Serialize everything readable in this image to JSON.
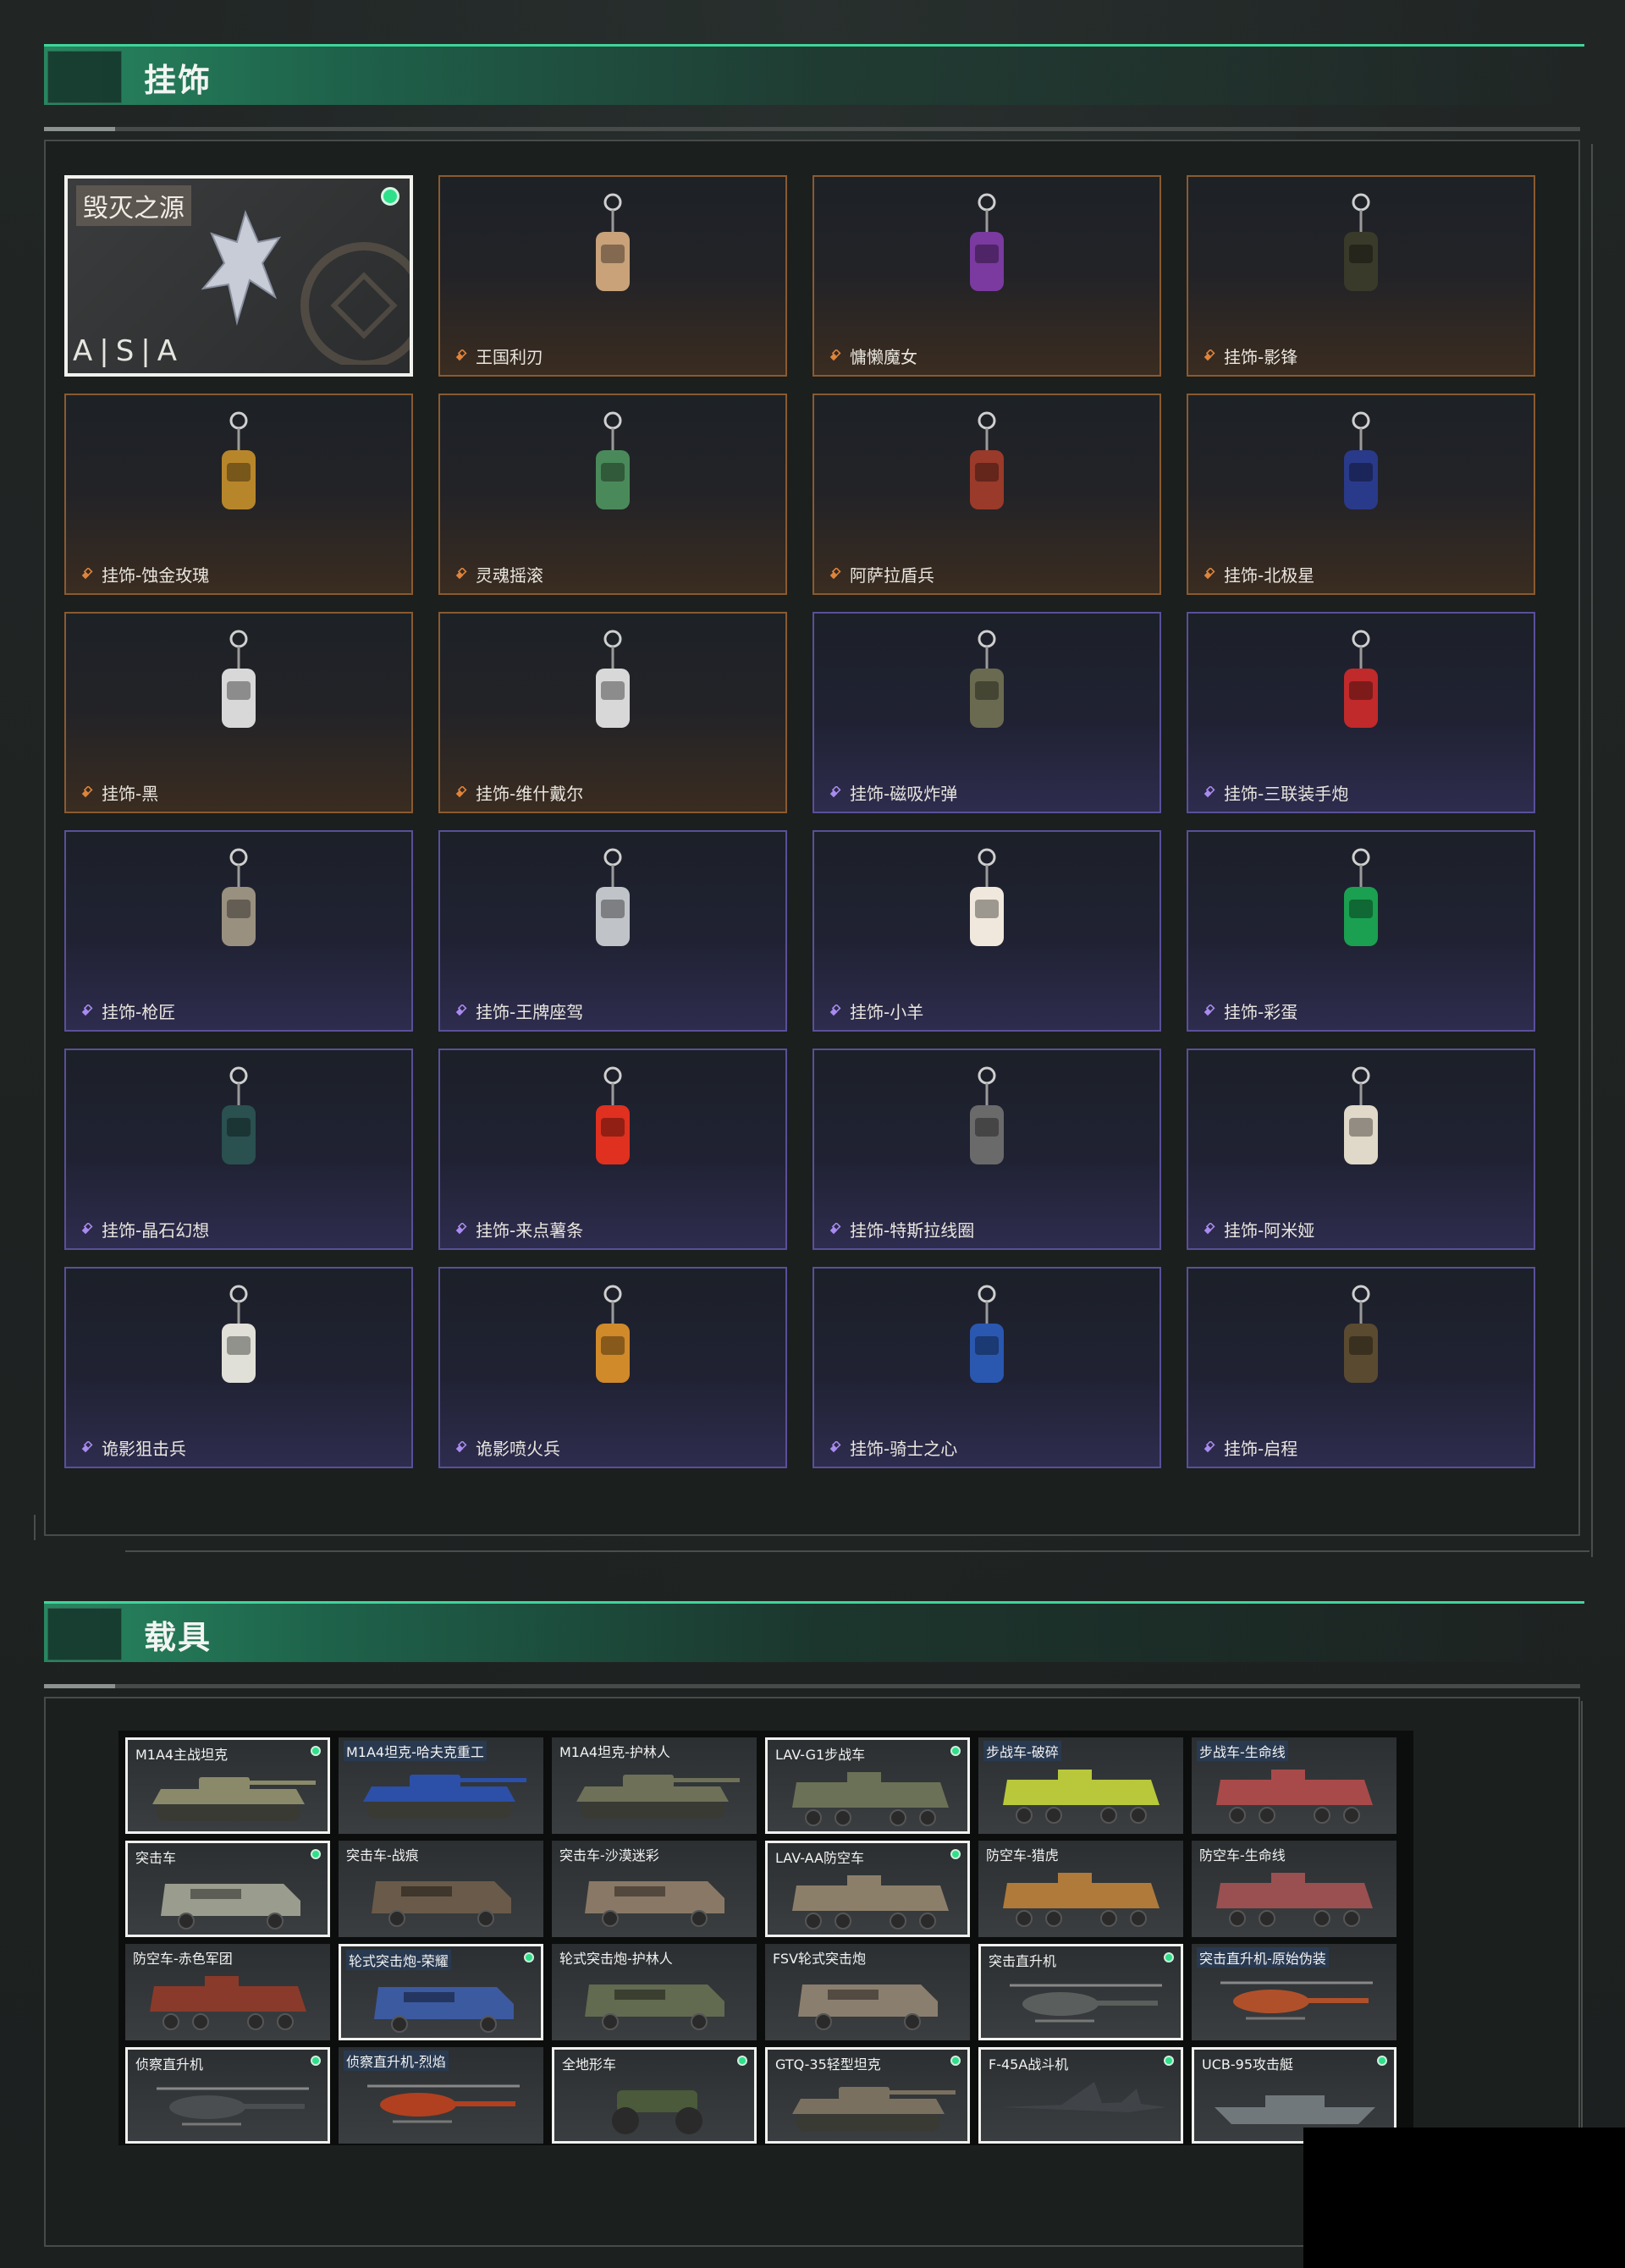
{
  "sections": {
    "charms": {
      "title": "挂饰"
    },
    "vehicles": {
      "title": "载具"
    }
  },
  "featured": {
    "title": "毁灭之源",
    "brand": "A|S|A"
  },
  "charms": [
    {
      "label": "王国利刃",
      "rarity": "orange"
    },
    {
      "label": "慵懒魔女",
      "rarity": "orange"
    },
    {
      "label": "挂饰-影锋",
      "rarity": "orange"
    },
    {
      "label": "挂饰-蚀金玫瑰",
      "rarity": "orange"
    },
    {
      "label": "灵魂摇滚",
      "rarity": "orange"
    },
    {
      "label": "阿萨拉盾兵",
      "rarity": "orange"
    },
    {
      "label": "挂饰-北极星",
      "rarity": "orange"
    },
    {
      "label": "挂饰-黑",
      "rarity": "orange"
    },
    {
      "label": "挂饰-维什戴尔",
      "rarity": "orange"
    },
    {
      "label": "挂饰-磁吸炸弹",
      "rarity": "purple"
    },
    {
      "label": "挂饰-三联装手炮",
      "rarity": "purple"
    },
    {
      "label": "挂饰-枪匠",
      "rarity": "purple"
    },
    {
      "label": "挂饰-王牌座驾",
      "rarity": "purple"
    },
    {
      "label": "挂饰-小羊",
      "rarity": "purple"
    },
    {
      "label": "挂饰-彩蛋",
      "rarity": "purple"
    },
    {
      "label": "挂饰-晶石幻想",
      "rarity": "purple"
    },
    {
      "label": "挂饰-来点薯条",
      "rarity": "purple"
    },
    {
      "label": "挂饰-特斯拉线圈",
      "rarity": "purple"
    },
    {
      "label": "挂饰-阿米娅",
      "rarity": "purple"
    },
    {
      "label": "诡影狙击兵",
      "rarity": "purple"
    },
    {
      "label": "诡影喷火兵",
      "rarity": "purple"
    },
    {
      "label": "挂饰-骑士之心",
      "rarity": "purple"
    },
    {
      "label": "挂饰-启程",
      "rarity": "purple"
    }
  ],
  "vehicles": [
    {
      "label": "M1A4主战坦克",
      "selected": true,
      "dot": true,
      "kind": "tank",
      "color": "#8a8a6a"
    },
    {
      "label": "M1A4坦克-哈夫克重工",
      "selected": false,
      "dot": false,
      "kind": "tank",
      "color": "#2c4fa8"
    },
    {
      "label": "M1A4坦克-护林人",
      "selected": false,
      "dot": false,
      "kind": "tank",
      "color": "#6e7058"
    },
    {
      "label": "LAV-G1步战车",
      "selected": true,
      "dot": true,
      "kind": "apc",
      "color": "#6b7157"
    },
    {
      "label": "步战车-破碎",
      "selected": false,
      "dot": false,
      "kind": "apc",
      "color": "#b8c83a"
    },
    {
      "label": "步战车-生命线",
      "selected": false,
      "dot": false,
      "kind": "apc",
      "color": "#a84a4a"
    },
    {
      "label": "突击车",
      "selected": true,
      "dot": true,
      "kind": "truck",
      "color": "#9a9c8e"
    },
    {
      "label": "突击车-战痕",
      "selected": false,
      "dot": false,
      "kind": "truck",
      "color": "#6a5a4a"
    },
    {
      "label": "突击车-沙漠迷彩",
      "selected": false,
      "dot": false,
      "kind": "truck",
      "color": "#8a7866"
    },
    {
      "label": "LAV-AA防空车",
      "selected": true,
      "dot": true,
      "kind": "apc",
      "color": "#8c7f6a"
    },
    {
      "label": "防空车-猎虎",
      "selected": false,
      "dot": false,
      "kind": "apc",
      "color": "#b07a3a"
    },
    {
      "label": "防空车-生命线",
      "selected": false,
      "dot": false,
      "kind": "apc",
      "color": "#9a5050"
    },
    {
      "label": "防空车-赤色军团",
      "selected": false,
      "dot": false,
      "kind": "apc",
      "color": "#8a3a2a"
    },
    {
      "label": "轮式突击炮-荣耀",
      "selected": true,
      "dot": true,
      "kind": "truck",
      "color": "#3c5aa0"
    },
    {
      "label": "轮式突击炮-护林人",
      "selected": false,
      "dot": false,
      "kind": "truck",
      "color": "#626a50"
    },
    {
      "label": "FSV轮式突击炮",
      "selected": false,
      "dot": false,
      "kind": "truck",
      "color": "#8a7e6e"
    },
    {
      "label": "突击直升机",
      "selected": true,
      "dot": true,
      "kind": "heli",
      "color": "#5a5e5c"
    },
    {
      "label": "突击直升机-原始伪装",
      "selected": false,
      "dot": false,
      "kind": "heli",
      "color": "#b0502a"
    },
    {
      "label": "侦察直升机",
      "selected": true,
      "dot": true,
      "kind": "heli",
      "color": "#4a4e50"
    },
    {
      "label": "侦察直升机-烈焰",
      "selected": false,
      "dot": false,
      "kind": "heli",
      "color": "#b04020"
    },
    {
      "label": "全地形车",
      "selected": true,
      "dot": true,
      "kind": "atv",
      "color": "#4a5a3a"
    },
    {
      "label": "GTQ-35轻型坦克",
      "selected": true,
      "dot": true,
      "kind": "tank",
      "color": "#7a7060"
    },
    {
      "label": "F-45A战斗机",
      "selected": true,
      "dot": true,
      "kind": "jet",
      "color": "#404448"
    },
    {
      "label": "UCB-95攻击艇",
      "selected": true,
      "dot": true,
      "kind": "boat",
      "color": "#70787c"
    }
  ],
  "vehicle_tag_labels": [
    1,
    4,
    5,
    13,
    17,
    19
  ],
  "colors": {
    "accent_green": "#2ee08a",
    "orange_border": "#8a5a30",
    "purple_border": "#5a4f9a"
  }
}
